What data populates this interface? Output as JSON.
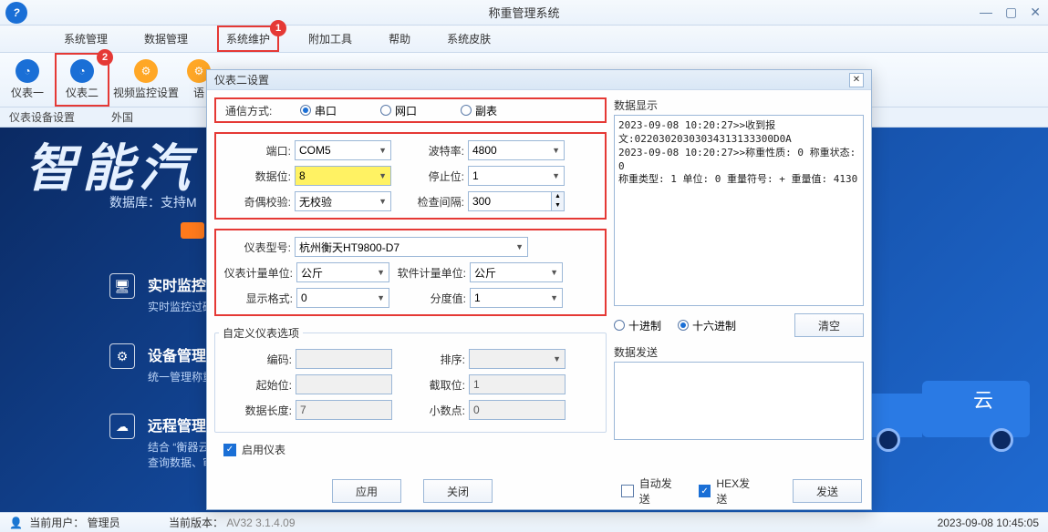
{
  "window": {
    "title": "称重管理系统"
  },
  "menubar": {
    "items": [
      "系统管理",
      "数据管理",
      "系统维护",
      "附加工具",
      "帮助",
      "系统皮肤"
    ]
  },
  "toolbar": {
    "items": [
      {
        "label": "仪表一",
        "icon": "gauge-icon"
      },
      {
        "label": "仪表二",
        "icon": "gauge-icon"
      },
      {
        "label": "视频监控设置",
        "icon": "gear-icon"
      },
      {
        "label": "语",
        "icon": "gear-icon"
      }
    ]
  },
  "subbar": {
    "left": "仪表设备设置",
    "right": "外国"
  },
  "banner": {
    "big_text": "智能汽",
    "db_text": "数据库：支持M"
  },
  "features": [
    {
      "title": "实时监控",
      "desc": "实时监控过磅"
    },
    {
      "title": "设备管理",
      "desc": "统一管理称重"
    },
    {
      "title": "远程管理",
      "desc": "结合 “衡器云\n查询数据、审"
    }
  ],
  "truck_label": "云",
  "statusbar": {
    "user_label": "当前用户：",
    "user_value": "管理员",
    "version_label": "当前版本：",
    "version_value": "AV32 3.1.4.09",
    "datetime": "2023-09-08 10:45:05"
  },
  "dialog": {
    "title": "仪表二设置",
    "comm": {
      "label": "通信方式:",
      "opts": [
        "串口",
        "网口",
        "副表"
      ],
      "selected": "串口"
    },
    "serial": {
      "port_label": "端口:",
      "port_value": "COM5",
      "baud_label": "波特率:",
      "baud_value": "4800",
      "databits_label": "数据位:",
      "databits_value": "8",
      "stopbits_label": "停止位:",
      "stopbits_value": "1",
      "parity_label": "奇偶校验:",
      "parity_value": "无校验",
      "interval_label": "检查间隔:",
      "interval_value": "300"
    },
    "meter": {
      "model_label": "仪表型号:",
      "model_value": "杭州衡天HT9800-D7",
      "meter_unit_label": "仪表计量单位:",
      "meter_unit_value": "公斤",
      "soft_unit_label": "软件计量单位:",
      "soft_unit_value": "公斤",
      "disp_fmt_label": "显示格式:",
      "disp_fmt_value": "0",
      "division_label": "分度值:",
      "division_value": "1"
    },
    "custom": {
      "legend": "自定义仪表选项",
      "code_label": "编码:",
      "code_value": "",
      "order_label": "排序:",
      "order_value": "",
      "start_label": "起始位:",
      "start_value": "",
      "cut_label": "截取位:",
      "cut_value": "1",
      "len_label": "数据长度:",
      "len_value": "7",
      "decimal_label": "小数点:",
      "decimal_value": "0"
    },
    "enable_label": "启用仪表",
    "buttons": {
      "apply": "应用",
      "close": "关闭"
    },
    "right": {
      "display_title": "数据显示",
      "display_text": "2023-09-08 10:20:27>>收到报\n文:02203020303034313133300D0A\n2023-09-08 10:20:27>>称重性质: 0 称重状态: 0\n称重类型: 1 单位: 0 重量符号: + 重量值: 4130",
      "radix_dec": "十进制",
      "radix_hex": "十六进制",
      "clear": "清空",
      "send_title": "数据发送",
      "auto_send": "自动发送",
      "hex_send": "HEX发送",
      "send": "发送"
    }
  },
  "annotations": {
    "badge1": "1",
    "badge2": "2"
  }
}
